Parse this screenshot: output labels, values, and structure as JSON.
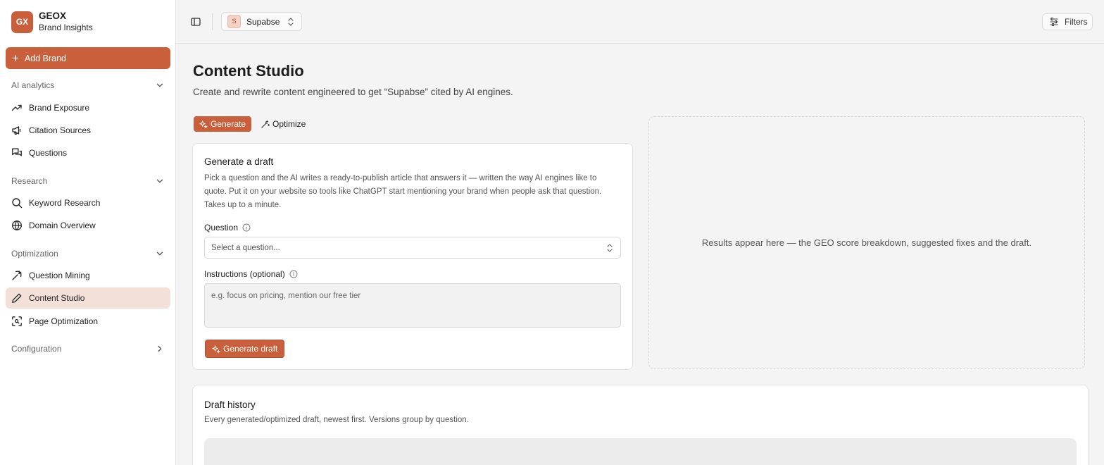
{
  "sidebar": {
    "logo_initials": "GX",
    "brand_name": "GEOX",
    "brand_sub": "Brand Insights",
    "add_brand_label": "Add Brand",
    "sections": {
      "ai_analytics": "AI analytics",
      "research": "Research",
      "optimization": "Optimization",
      "configuration": "Configuration"
    },
    "items": {
      "brand_exposure": "Brand Exposure",
      "citation_sources": "Citation Sources",
      "questions": "Questions",
      "keyword_research": "Keyword Research",
      "domain_overview": "Domain Overview",
      "question_mining": "Question Mining",
      "content_studio": "Content Studio",
      "page_optimization": "Page Optimization"
    },
    "active_item": "Content Studio"
  },
  "topbar": {
    "brand_avatar": "S",
    "brand_selected": "Supabse",
    "filters_label": "Filters"
  },
  "main": {
    "title": "Content Studio",
    "subtitle": "Create and rewrite content engineered to get “Supabse” cited by AI engines.",
    "tabs": {
      "generate": "Generate",
      "optimize": "Optimize"
    },
    "draft_card": {
      "title": "Generate a draft",
      "description": "Pick a question and the AI writes a ready-to-publish article that answers it — written the way AI engines like to quote. Put it on your website so tools like ChatGPT start mentioning your brand when people ask that question. Takes up to a minute.",
      "question_label": "Question",
      "question_placeholder": "Select a question...",
      "instructions_label": "Instructions (optional)",
      "instructions_placeholder": "e.g. focus on pricing, mention our free tier",
      "submit_label": "Generate draft"
    },
    "results_placeholder": "Results appear here — the GEO score breakdown, suggested fixes and the draft.",
    "history": {
      "title": "Draft history",
      "subtitle": "Every generated/optimized draft, newest first. Versions group by question."
    }
  },
  "colors": {
    "accent": "#c9603b",
    "active_bg": "#f3e1d9",
    "page_bg": "#f4f4f4"
  }
}
